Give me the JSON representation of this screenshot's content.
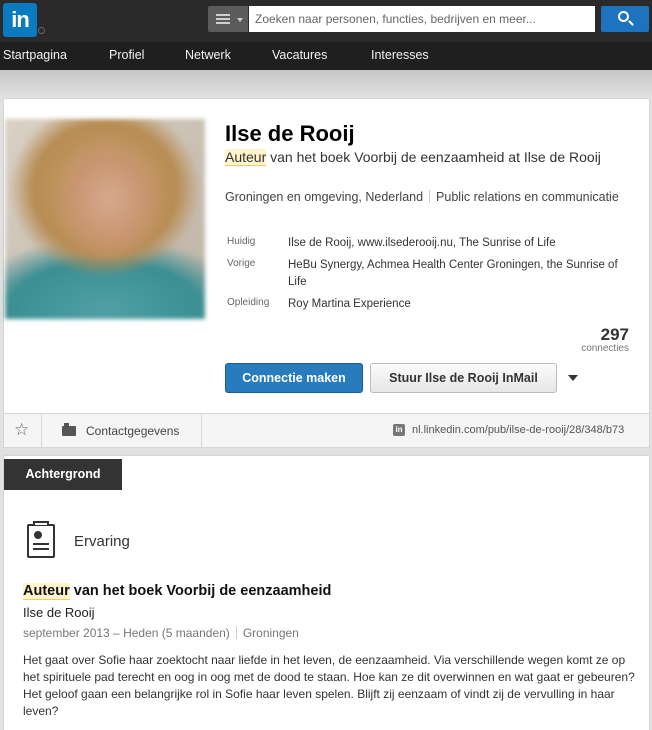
{
  "header": {
    "logo_text": "in",
    "search": {
      "placeholder": "Zoeken naar personen, functies, bedrijven en meer..."
    }
  },
  "nav": {
    "items": [
      "Startpagina",
      "Profiel",
      "Netwerk",
      "Vacatures",
      "Interesses"
    ]
  },
  "profile": {
    "name": "Ilse de Rooij",
    "headline_highlight": "Auteur",
    "headline_rest": " van het boek Voorbij de eenzaamheid at Ilse de Rooij",
    "location": "Groningen en omgeving, Nederland",
    "industry": "Public relations en communicatie",
    "facts": [
      {
        "label": "Huidig",
        "value": "Ilse de Rooij, www.ilsederooij.nu, The Sunrise of Life"
      },
      {
        "label": "Vorige",
        "value": "HeBu Synergy, Achmea Health Center Groningen, the Sunrise of Life"
      },
      {
        "label": "Opleiding",
        "value": "Roy Martina Experience"
      }
    ],
    "connections_count": "297",
    "connections_label": "connecties",
    "connect_button": "Connectie maken",
    "inmail_button": "Stuur Ilse de Rooij InMail",
    "contact_label": "Contactgegevens",
    "public_url": "nl.linkedin.com/pub/ilse-de-rooij/28/348/b73",
    "url_icon_text": "in"
  },
  "background": {
    "tab_label": "Achtergrond",
    "section_title": "Ervaring",
    "position": {
      "title_highlight": "Auteur",
      "title_rest": " van het boek Voorbij de eenzaamheid",
      "company": "Ilse de Rooij",
      "dates": "september 2013 – Heden (5 maanden)",
      "location": "Groningen",
      "description": "Het gaat over Sofie haar zoektocht naar liefde in het leven, de eenzaamheid. Via verschillende wegen komt ze op het spirituele pad terecht en oog in oog met de dood te staan. Hoe kan ze dit overwinnen en wat gaat er gebeuren? Het geloof gaan een belangrijke rol in Sofie haar leven spelen. Blijft zij eenzaam of vindt zij de vervulling in haar leven?"
    }
  },
  "colors": {
    "brand_blue": "#0a7bc0",
    "connect_blue": "#287bbc",
    "topbar": "#2a2a2a",
    "highlight": "#fff4cc"
  },
  "icons": [
    "search-category-icon",
    "search-icon",
    "star-icon",
    "contact-card-icon",
    "linkedin-url-icon",
    "experience-document-icon",
    "more-caret-icon"
  ]
}
